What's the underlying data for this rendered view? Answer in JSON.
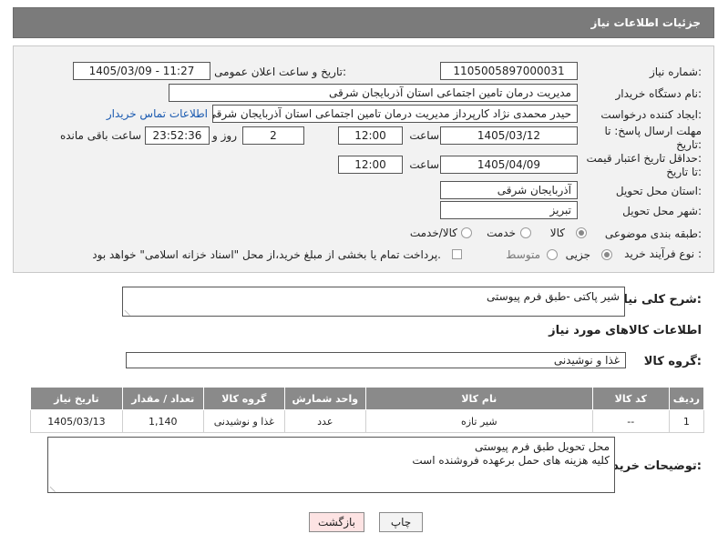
{
  "header": {
    "title": "جزئیات اطلاعات نیاز"
  },
  "fields": {
    "need_number_label": "شماره نیاز:",
    "need_number": "1105005897000031",
    "announce_label": "تاریخ و ساعت اعلان عمومی:",
    "announce_value": "1405/03/09 - 11:27",
    "buyer_org_label": "نام دستگاه خریدار:",
    "buyer_org": "مدیریت درمان تامین اجتماعی استان آذربایجان شرقی",
    "creator_label": "ایجاد کننده درخواست:",
    "creator": "حیدر محمدی نژاد کارپرداز مدیریت درمان تامین اجتماعی استان آذربایجان شرقی",
    "contact_link": "اطلاعات تماس خریدار",
    "reply_deadline_label_1": "مهلت ارسال پاسخ: تا",
    "reply_deadline_label_2": "تاریخ:",
    "reply_date": "1405/03/12",
    "time_label": "ساعت",
    "reply_time": "12:00",
    "days_value": "2",
    "days_label": "روز و",
    "remaining_time": "23:52:36",
    "remaining_label": "ساعت باقی مانده",
    "price_validity_label_1": "حداقل تاریخ اعتبار قیمت:",
    "price_validity_label_2": "تا تاریخ:",
    "price_date": "1405/04/09",
    "price_time": "12:00",
    "delivery_province_label": "استان محل تحویل:",
    "delivery_province": "آذربایجان شرقی",
    "delivery_city_label": "شهر محل تحویل:",
    "delivery_city": "تبریز",
    "category_label": "طبقه بندی موضوعی:",
    "category_options": [
      "کالا",
      "خدمت",
      "کالا/خدمت"
    ],
    "process_label": "نوع فرآیند خرید :",
    "process_options": [
      "جزیی",
      "متوسط"
    ],
    "payment_note": "پرداخت تمام یا بخشی از مبلغ خرید،از محل \"اسناد خزانه اسلامی\" خواهد بود."
  },
  "description": {
    "label": "شرح کلی نیاز:",
    "value": "شیر پاکتی -طبق فرم پیوستی"
  },
  "goods_section": {
    "title": "اطلاعات کالاهای مورد نیاز",
    "group_label": "گروه کالا:",
    "group_value": "غذا و نوشیدنی"
  },
  "table": {
    "headers": [
      "ردیف",
      "کد کالا",
      "نام کالا",
      "واحد شمارش",
      "گروه کالا",
      "تعداد / مقدار",
      "تاریخ نیاز"
    ],
    "rows": [
      [
        "1",
        "--",
        "شیر تازه",
        "عدد",
        "غذا و نوشیدنی",
        "1,140",
        "1405/03/13"
      ]
    ]
  },
  "buyer_notes": {
    "label": "توضیحات خریدار:",
    "line1": "محل تحویل طبق فرم پیوستی",
    "line2": "کلیه هزینه های حمل برعهده فروشنده است"
  },
  "buttons": {
    "print": "چاپ",
    "back": "بازگشت"
  },
  "colors": {
    "header_bg": "#7b7b7b",
    "link": "#1a5ab0",
    "back_button_bg": "#fde3e3"
  }
}
